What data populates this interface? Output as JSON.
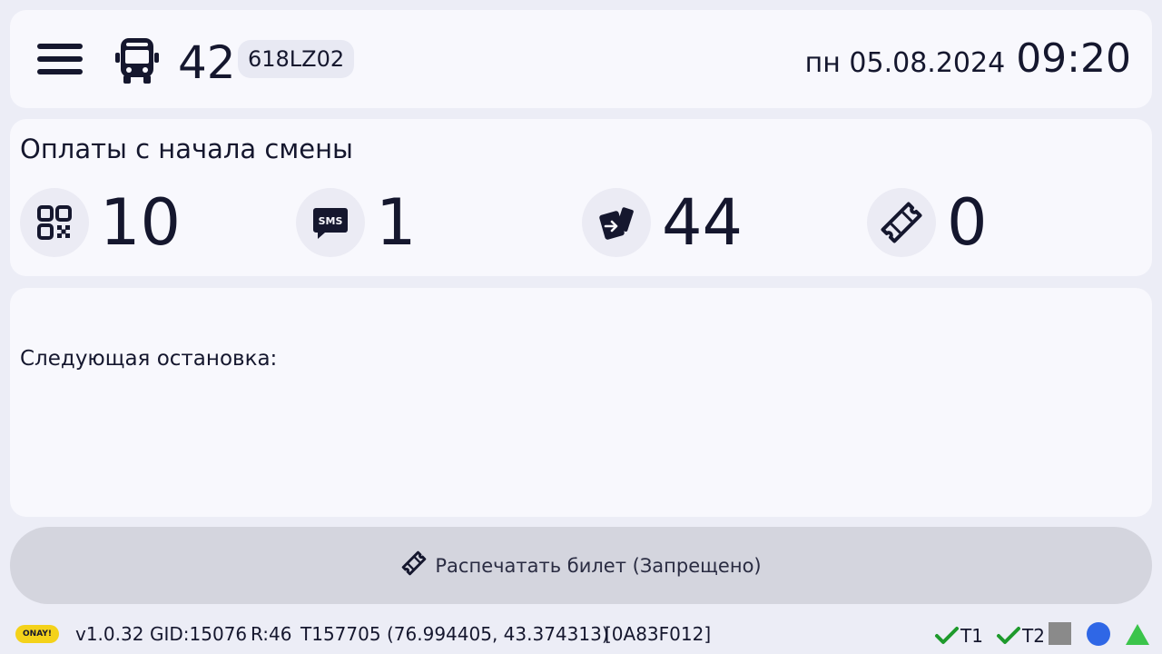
{
  "header": {
    "route_number": "42",
    "vehicle_plate": "618LZ02",
    "date": "пн 05.08.2024",
    "time": "09:20",
    "icons": {
      "menu": "menu-icon",
      "vehicle": "bus-icon"
    }
  },
  "payments": {
    "title": "Оплаты с начала смены",
    "stats": [
      {
        "icon": "qr-code-icon",
        "value": "10"
      },
      {
        "icon": "sms-icon",
        "value": "1"
      },
      {
        "icon": "card-payment-icon",
        "value": "44"
      },
      {
        "icon": "ticket-icon",
        "value": "0"
      }
    ]
  },
  "next_stop": {
    "label": "Следующая остановка:",
    "value": ""
  },
  "print_button": {
    "label": "Распечатать билет (Запрещено)",
    "icon": "ticket-icon",
    "enabled": false
  },
  "status_bar": {
    "brand": "ONAY!",
    "version": "v1.0.32",
    "gid": "GID:15076",
    "r": "R:46",
    "t": "T157705",
    "coords": "(76.994405, 43.374313)",
    "device_id": "[0A83F012]",
    "indicators": [
      {
        "label": "T1",
        "state": "ok",
        "color": "#1e9a2c"
      },
      {
        "label": "T2",
        "state": "ok",
        "color": "#1e9a2c"
      },
      {
        "label": "",
        "state": "square",
        "color": "#8a8a8a"
      },
      {
        "label": "",
        "state": "circle",
        "color": "#2f67e6"
      },
      {
        "label": "",
        "state": "triangle",
        "color": "#3bc44b"
      }
    ]
  },
  "colors": {
    "background": "#ecedf6",
    "card": "#f8f8fd",
    "text": "#15172e",
    "disabled_button": "#d4d5de",
    "brand_yellow": "#f4d21a"
  }
}
